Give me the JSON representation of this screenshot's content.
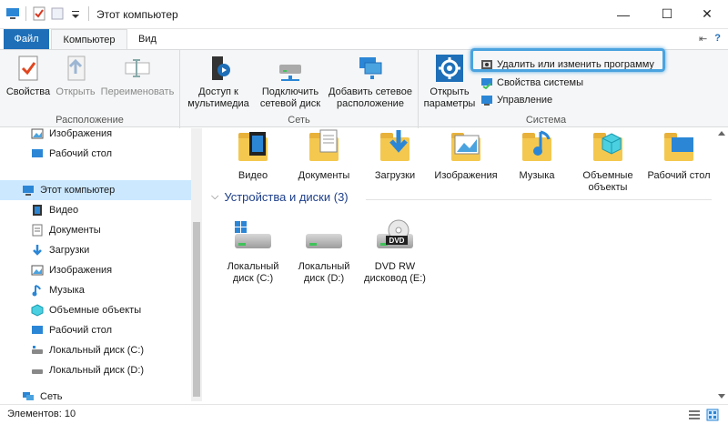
{
  "window": {
    "title": "Этот компьютер",
    "minimize": "—",
    "maximize": "☐",
    "close": "✕"
  },
  "tabs": {
    "file": "Файл",
    "computer": "Компьютер",
    "view": "Вид",
    "pin": "⇤",
    "help": "?"
  },
  "ribbon": {
    "location": {
      "label": "Расположение",
      "properties": "Свойства",
      "open": "Открыть",
      "rename": "Переименовать"
    },
    "network": {
      "label": "Сеть",
      "media_access": "Доступ к мультимедиа",
      "map_drive": "Подключить сетевой диск",
      "add_location": "Добавить сетевое расположение"
    },
    "system": {
      "label": "Система",
      "open_settings": "Открыть параметры",
      "uninstall": "Удалить или изменить программу",
      "system_properties": "Свойства системы",
      "manage": "Управление"
    }
  },
  "nav": {
    "items": [
      {
        "label": "Изображения",
        "icon": "pictures-icon"
      },
      {
        "label": "Рабочий стол",
        "icon": "desktop-icon"
      },
      {
        "label": "Этот компьютер",
        "icon": "computer-icon"
      },
      {
        "label": "Видео",
        "icon": "video-icon"
      },
      {
        "label": "Документы",
        "icon": "documents-icon"
      },
      {
        "label": "Загрузки",
        "icon": "downloads-icon"
      },
      {
        "label": "Изображения",
        "icon": "pictures-icon"
      },
      {
        "label": "Музыка",
        "icon": "music-icon"
      },
      {
        "label": "Объемные объекты",
        "icon": "3d-objects-icon"
      },
      {
        "label": "Рабочий стол",
        "icon": "desktop-icon"
      },
      {
        "label": "Локальный диск (C:)",
        "icon": "drive-icon"
      },
      {
        "label": "Локальный диск (D:)",
        "icon": "drive-icon"
      },
      {
        "label": "Сеть",
        "icon": "network-icon"
      }
    ]
  },
  "folders": [
    {
      "label": "Видео"
    },
    {
      "label": "Документы"
    },
    {
      "label": "Загрузки"
    },
    {
      "label": "Изображения"
    },
    {
      "label": "Музыка"
    },
    {
      "label": "Объемные объекты"
    },
    {
      "label": "Рабочий стол"
    }
  ],
  "devices": {
    "header": "Устройства и диски (3)",
    "items": [
      {
        "label": "Локальный диск (C:)"
      },
      {
        "label": "Локальный диск (D:)"
      },
      {
        "label": "DVD RW дисковод (E:)",
        "badge": "DVD"
      }
    ]
  },
  "status": {
    "count": "Элементов: 10"
  },
  "colors": {
    "accent": "#1e6fb8",
    "highlight": "#4aa3df",
    "folder": "#f4c84f",
    "selection": "#cce8ff"
  }
}
